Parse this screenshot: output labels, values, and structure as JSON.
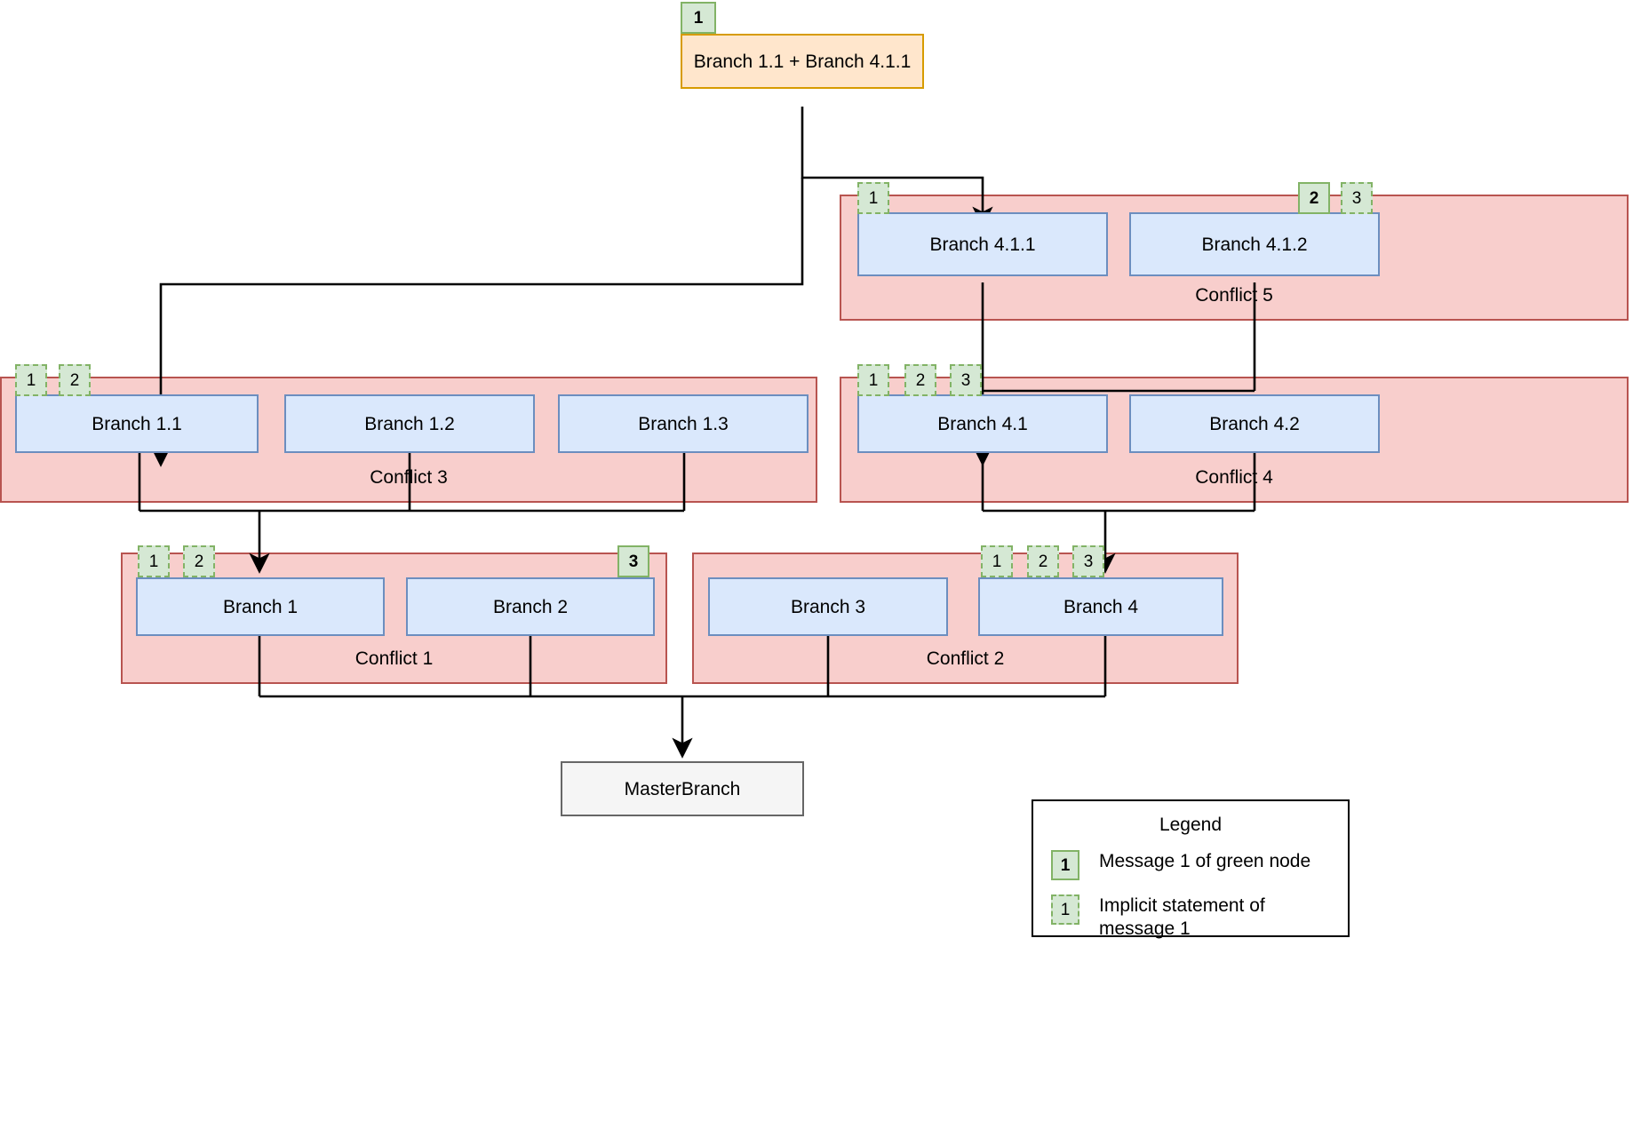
{
  "diagram": {
    "title": "Branch conflict merge diagram",
    "colors": {
      "node_fill": "#dae8fc",
      "node_stroke": "#6c8ebf",
      "group_fill": "#f8cecc",
      "group_stroke": "#b85450",
      "badge_fill": "#d5e8d4",
      "badge_stroke": "#82b366",
      "merge_fill": "#ffe6cc",
      "merge_stroke": "#d79b00",
      "master_fill": "#f5f5f5",
      "master_stroke": "#666666",
      "edge_stroke": "#000000"
    }
  },
  "merge_node": {
    "label": "Branch 1.1 + Branch 4.1.1",
    "badges": [
      {
        "text": "1",
        "style": "solid"
      }
    ]
  },
  "groups": [
    {
      "id": "conflict-5",
      "label": "Conflict 5",
      "nodes": [
        {
          "id": "branch-4-1-1",
          "label": "Branch 4.1.1"
        },
        {
          "id": "branch-4-1-2",
          "label": "Branch 4.1.2"
        }
      ],
      "badges": [
        {
          "text": "1",
          "style": "implicit"
        },
        {
          "text": "2",
          "style": "solid"
        },
        {
          "text": "3",
          "style": "implicit"
        }
      ]
    },
    {
      "id": "conflict-3",
      "label": "Conflict 3",
      "nodes": [
        {
          "id": "branch-1-1",
          "label": "Branch 1.1"
        },
        {
          "id": "branch-1-2",
          "label": "Branch 1.2"
        },
        {
          "id": "branch-1-3",
          "label": "Branch 1.3"
        }
      ],
      "badges": [
        {
          "text": "1",
          "style": "implicit"
        },
        {
          "text": "2",
          "style": "implicit"
        }
      ]
    },
    {
      "id": "conflict-4",
      "label": "Conflict 4",
      "nodes": [
        {
          "id": "branch-4-1",
          "label": "Branch 4.1"
        },
        {
          "id": "branch-4-2",
          "label": "Branch 4.2"
        }
      ],
      "badges": [
        {
          "text": "1",
          "style": "implicit"
        },
        {
          "text": "2",
          "style": "implicit"
        },
        {
          "text": "3",
          "style": "implicit"
        }
      ]
    },
    {
      "id": "conflict-1",
      "label": "Conflict 1",
      "nodes": [
        {
          "id": "branch-1",
          "label": "Branch 1"
        },
        {
          "id": "branch-2",
          "label": "Branch 2"
        }
      ],
      "badges": [
        {
          "text": "1",
          "style": "implicit"
        },
        {
          "text": "2",
          "style": "implicit"
        },
        {
          "text": "3",
          "style": "solid"
        }
      ]
    },
    {
      "id": "conflict-2",
      "label": "Conflict 2",
      "nodes": [
        {
          "id": "branch-3",
          "label": "Branch 3"
        },
        {
          "id": "branch-4",
          "label": "Branch 4"
        }
      ],
      "badges": [
        {
          "text": "1",
          "style": "implicit"
        },
        {
          "text": "2",
          "style": "implicit"
        },
        {
          "text": "3",
          "style": "implicit"
        }
      ]
    }
  ],
  "master_node": {
    "label": "MasterBranch"
  },
  "legend": {
    "title": "Legend",
    "items": [
      {
        "badge": "1",
        "style": "solid",
        "text": "Message 1 of green node"
      },
      {
        "badge": "1",
        "style": "implicit",
        "text": "Implicit statement of message 1"
      }
    ]
  }
}
